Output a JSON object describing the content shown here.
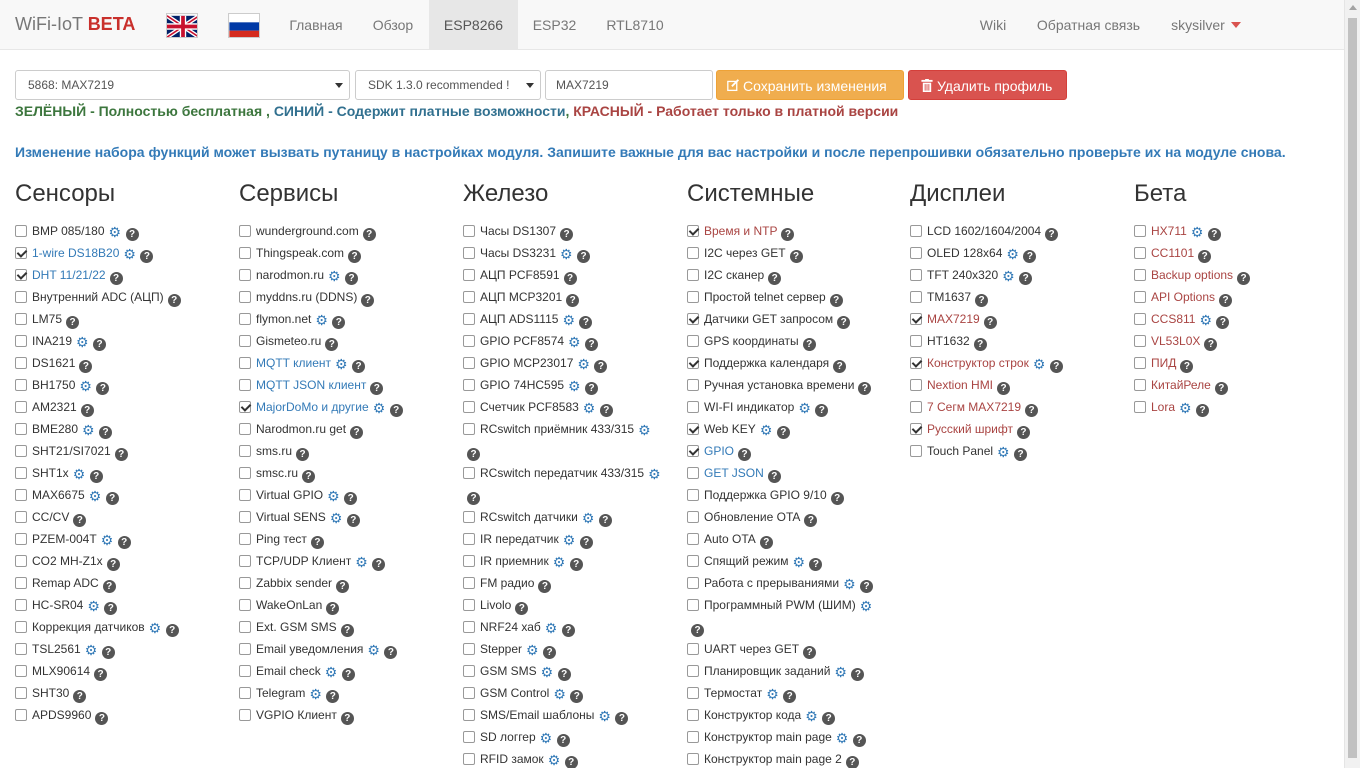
{
  "navbar": {
    "brand_name": "WiFi-IoT",
    "brand_badge": "BETA",
    "links": [
      "Главная",
      "Обзор",
      "ESP8266",
      "ESP32",
      "RTL8710"
    ],
    "active_link": "ESP8266",
    "right_links": [
      "Wiki",
      "Обратная связь"
    ],
    "user": "skysilver"
  },
  "toolbar": {
    "profile_select": "5868: MAX7219",
    "sdk_select": "SDK 1.3.0 recommended !",
    "profile_name": "MAX7219",
    "save_label": "Сохранить изменения",
    "delete_label": "Удалить профиль"
  },
  "legend": {
    "green": "ЗЕЛЁНЫЙ - Полностью бесплатная",
    "sep": " , ",
    "blue": "СИНИЙ - Содержит платные возможности",
    "red": "КРАСНЫЙ - Работает только в платной версии"
  },
  "notice": "Изменение набора функций может вызвать путаницу в настройках модуля. Запишите важные для вас настройки и после перепрошивки обязательно проверьте их на модуле снова.",
  "columns": [
    {
      "title": "Сенсоры",
      "items": [
        {
          "label": "BMP 085/180",
          "checked": false,
          "gear": true,
          "color": "default"
        },
        {
          "label": "1-wire DS18B20",
          "checked": true,
          "gear": true,
          "color": "blue"
        },
        {
          "label": "DHT 11/21/22",
          "checked": true,
          "gear": false,
          "color": "blue"
        },
        {
          "label": "Внутренний ADC (АЦП)",
          "checked": false,
          "gear": false,
          "color": "default"
        },
        {
          "label": "LM75",
          "checked": false,
          "gear": false,
          "color": "default"
        },
        {
          "label": "INA219",
          "checked": false,
          "gear": true,
          "color": "default"
        },
        {
          "label": "DS1621",
          "checked": false,
          "gear": false,
          "color": "default"
        },
        {
          "label": "BH1750",
          "checked": false,
          "gear": true,
          "color": "default"
        },
        {
          "label": "AM2321",
          "checked": false,
          "gear": false,
          "color": "default"
        },
        {
          "label": "BME280",
          "checked": false,
          "gear": true,
          "color": "default"
        },
        {
          "label": "SHT21/SI7021",
          "checked": false,
          "gear": false,
          "color": "default"
        },
        {
          "label": "SHT1x",
          "checked": false,
          "gear": true,
          "color": "default"
        },
        {
          "label": "MAX6675",
          "checked": false,
          "gear": true,
          "color": "default"
        },
        {
          "label": "CC/CV",
          "checked": false,
          "gear": false,
          "color": "default"
        },
        {
          "label": "PZEM-004T",
          "checked": false,
          "gear": true,
          "color": "default"
        },
        {
          "label": "CO2 MH-Z1x",
          "checked": false,
          "gear": false,
          "color": "default"
        },
        {
          "label": "Remap ADC",
          "checked": false,
          "gear": false,
          "color": "default"
        },
        {
          "label": "HC-SR04",
          "checked": false,
          "gear": true,
          "color": "default"
        },
        {
          "label": "Коррекция датчиков",
          "checked": false,
          "gear": true,
          "color": "default"
        },
        {
          "label": "TSL2561",
          "checked": false,
          "gear": true,
          "color": "default"
        },
        {
          "label": "MLX90614",
          "checked": false,
          "gear": false,
          "color": "default"
        },
        {
          "label": "SHT30",
          "checked": false,
          "gear": false,
          "color": "default"
        },
        {
          "label": "APDS9960",
          "checked": false,
          "gear": false,
          "color": "default"
        }
      ]
    },
    {
      "title": "Сервисы",
      "items": [
        {
          "label": "wunderground.com",
          "checked": false,
          "gear": false,
          "color": "default"
        },
        {
          "label": "Thingspeak.com",
          "checked": false,
          "gear": false,
          "color": "default"
        },
        {
          "label": "narodmon.ru",
          "checked": false,
          "gear": true,
          "color": "default"
        },
        {
          "label": "myddns.ru (DDNS)",
          "checked": false,
          "gear": false,
          "color": "default"
        },
        {
          "label": "flymon.net",
          "checked": false,
          "gear": true,
          "color": "default"
        },
        {
          "label": "Gismeteo.ru",
          "checked": false,
          "gear": false,
          "color": "default"
        },
        {
          "label": "MQTT клиент",
          "checked": false,
          "gear": true,
          "color": "blue"
        },
        {
          "label": "MQTT JSON клиент",
          "checked": false,
          "gear": false,
          "color": "blue"
        },
        {
          "label": "MajorDoMo и другие",
          "checked": true,
          "gear": true,
          "color": "blue"
        },
        {
          "label": "Narodmon.ru get",
          "checked": false,
          "gear": false,
          "color": "default"
        },
        {
          "label": "sms.ru",
          "checked": false,
          "gear": false,
          "color": "default"
        },
        {
          "label": "smsc.ru",
          "checked": false,
          "gear": false,
          "color": "default"
        },
        {
          "label": "Virtual GPIO",
          "checked": false,
          "gear": true,
          "color": "default"
        },
        {
          "label": "Virtual SENS",
          "checked": false,
          "gear": true,
          "color": "default"
        },
        {
          "label": "Ping тест",
          "checked": false,
          "gear": false,
          "color": "default"
        },
        {
          "label": "TCP/UDP Клиент",
          "checked": false,
          "gear": true,
          "color": "default"
        },
        {
          "label": "Zabbix sender",
          "checked": false,
          "gear": false,
          "color": "default"
        },
        {
          "label": "WakeOnLan",
          "checked": false,
          "gear": false,
          "color": "default"
        },
        {
          "label": "Ext. GSM SMS",
          "checked": false,
          "gear": false,
          "color": "default"
        },
        {
          "label": "Email уведомления",
          "checked": false,
          "gear": true,
          "color": "default"
        },
        {
          "label": "Email check",
          "checked": false,
          "gear": true,
          "color": "default"
        },
        {
          "label": "Telegram",
          "checked": false,
          "gear": true,
          "color": "default"
        },
        {
          "label": "VGPIO Клиент",
          "checked": false,
          "gear": false,
          "color": "default"
        }
      ]
    },
    {
      "title": "Железо",
      "items": [
        {
          "label": "Часы DS1307",
          "checked": false,
          "gear": false,
          "color": "default"
        },
        {
          "label": "Часы DS3231",
          "checked": false,
          "gear": true,
          "color": "default"
        },
        {
          "label": "АЦП PCF8591",
          "checked": false,
          "gear": false,
          "color": "default"
        },
        {
          "label": "АЦП MCP3201",
          "checked": false,
          "gear": false,
          "color": "default"
        },
        {
          "label": "АЦП ADS1115",
          "checked": false,
          "gear": true,
          "color": "default"
        },
        {
          "label": "GPIO PCF8574",
          "checked": false,
          "gear": true,
          "color": "default"
        },
        {
          "label": "GPIO MCP23017",
          "checked": false,
          "gear": true,
          "color": "default"
        },
        {
          "label": "GPIO 74HC595",
          "checked": false,
          "gear": true,
          "color": "default"
        },
        {
          "label": "Счетчик PCF8583",
          "checked": false,
          "gear": true,
          "color": "default"
        },
        {
          "label": "RCswitch приёмник 433/315",
          "checked": false,
          "gear": true,
          "color": "default",
          "wrap": true
        },
        {
          "label": "RCswitch передатчик 433/315",
          "checked": false,
          "gear": true,
          "color": "default",
          "wrap": true
        },
        {
          "label": "RCswitch датчики",
          "checked": false,
          "gear": true,
          "color": "default"
        },
        {
          "label": "IR передатчик",
          "checked": false,
          "gear": true,
          "color": "default"
        },
        {
          "label": "IR приемник",
          "checked": false,
          "gear": true,
          "color": "default"
        },
        {
          "label": "FM радио",
          "checked": false,
          "gear": false,
          "color": "default"
        },
        {
          "label": "Livolo",
          "checked": false,
          "gear": false,
          "color": "default"
        },
        {
          "label": "NRF24 хаб",
          "checked": false,
          "gear": true,
          "color": "default"
        },
        {
          "label": "Stepper",
          "checked": false,
          "gear": true,
          "color": "default"
        },
        {
          "label": "GSM SMS",
          "checked": false,
          "gear": true,
          "color": "default"
        },
        {
          "label": "GSM Control",
          "checked": false,
          "gear": true,
          "color": "default"
        },
        {
          "label": "SMS/Email шаблоны",
          "checked": false,
          "gear": true,
          "color": "default"
        },
        {
          "label": "SD логгер",
          "checked": false,
          "gear": true,
          "color": "default"
        },
        {
          "label": "RFID замок",
          "checked": false,
          "gear": true,
          "color": "default"
        }
      ]
    },
    {
      "title": "Системные",
      "items": [
        {
          "label": "Время и NTP",
          "checked": true,
          "gear": false,
          "color": "red"
        },
        {
          "label": "I2C через GET",
          "checked": false,
          "gear": false,
          "color": "default"
        },
        {
          "label": "I2C сканер",
          "checked": false,
          "gear": false,
          "color": "default"
        },
        {
          "label": "Простой telnet сервер",
          "checked": false,
          "gear": false,
          "color": "default"
        },
        {
          "label": "Датчики GET запросом",
          "checked": true,
          "gear": false,
          "color": "default"
        },
        {
          "label": "GPS координаты",
          "checked": false,
          "gear": false,
          "color": "default"
        },
        {
          "label": "Поддержка календаря",
          "checked": true,
          "gear": false,
          "color": "default"
        },
        {
          "label": "Ручная установка времени",
          "checked": false,
          "gear": false,
          "color": "default"
        },
        {
          "label": "WI-FI индикатор",
          "checked": false,
          "gear": true,
          "color": "default"
        },
        {
          "label": "Web KEY",
          "checked": true,
          "gear": true,
          "color": "default"
        },
        {
          "label": "GPIO",
          "checked": true,
          "gear": false,
          "color": "blue"
        },
        {
          "label": "GET JSON",
          "checked": false,
          "gear": false,
          "color": "blue"
        },
        {
          "label": "Поддержка GPIO 9/10",
          "checked": false,
          "gear": false,
          "color": "default"
        },
        {
          "label": "Обновление OTA",
          "checked": false,
          "gear": false,
          "color": "default"
        },
        {
          "label": "Auto OTA",
          "checked": false,
          "gear": false,
          "color": "default"
        },
        {
          "label": "Спящий режим",
          "checked": false,
          "gear": true,
          "color": "default"
        },
        {
          "label": "Работа с прерываниями",
          "checked": false,
          "gear": true,
          "color": "default"
        },
        {
          "label": "Программный PWM (ШИМ)",
          "checked": false,
          "gear": true,
          "color": "default",
          "wrap": true
        },
        {
          "label": "UART через GET",
          "checked": false,
          "gear": false,
          "color": "default"
        },
        {
          "label": "Планировщик заданий",
          "checked": false,
          "gear": true,
          "color": "default"
        },
        {
          "label": "Термостат",
          "checked": false,
          "gear": true,
          "color": "default"
        },
        {
          "label": "Конструктор кода",
          "checked": false,
          "gear": true,
          "color": "default"
        },
        {
          "label": "Конструктор main page",
          "checked": false,
          "gear": true,
          "color": "default"
        },
        {
          "label": "Конструктор main page 2",
          "checked": false,
          "gear": false,
          "color": "default"
        }
      ]
    },
    {
      "title": "Дисплеи",
      "items": [
        {
          "label": "LCD 1602/1604/2004",
          "checked": false,
          "gear": false,
          "color": "default"
        },
        {
          "label": "OLED 128x64",
          "checked": false,
          "gear": true,
          "color": "default"
        },
        {
          "label": "TFT 240x320",
          "checked": false,
          "gear": true,
          "color": "default"
        },
        {
          "label": "TM1637",
          "checked": false,
          "gear": false,
          "color": "default"
        },
        {
          "label": "MAX7219",
          "checked": true,
          "gear": false,
          "color": "red"
        },
        {
          "label": "HT1632",
          "checked": false,
          "gear": false,
          "color": "default"
        },
        {
          "label": "Конструктор строк",
          "checked": true,
          "gear": true,
          "color": "red"
        },
        {
          "label": "Nextion HMI",
          "checked": false,
          "gear": false,
          "color": "red"
        },
        {
          "label": "7 Сегм MAX7219",
          "checked": false,
          "gear": false,
          "color": "red"
        },
        {
          "label": "Русский шрифт",
          "checked": true,
          "gear": false,
          "color": "red"
        },
        {
          "label": "Touch Panel",
          "checked": false,
          "gear": true,
          "color": "default"
        }
      ]
    },
    {
      "title": "Бета",
      "items": [
        {
          "label": "HX711",
          "checked": false,
          "gear": true,
          "color": "red"
        },
        {
          "label": "CC1101",
          "checked": false,
          "gear": false,
          "color": "red"
        },
        {
          "label": "Backup options",
          "checked": false,
          "gear": false,
          "color": "red"
        },
        {
          "label": "API Options",
          "checked": false,
          "gear": false,
          "color": "red"
        },
        {
          "label": "CCS811",
          "checked": false,
          "gear": true,
          "color": "red"
        },
        {
          "label": "VL53L0X",
          "checked": false,
          "gear": false,
          "color": "red"
        },
        {
          "label": "ПИД",
          "checked": false,
          "gear": false,
          "color": "red"
        },
        {
          "label": "КитайРеле",
          "checked": false,
          "gear": false,
          "color": "red"
        },
        {
          "label": "Lora",
          "checked": false,
          "gear": true,
          "color": "red"
        }
      ]
    }
  ]
}
